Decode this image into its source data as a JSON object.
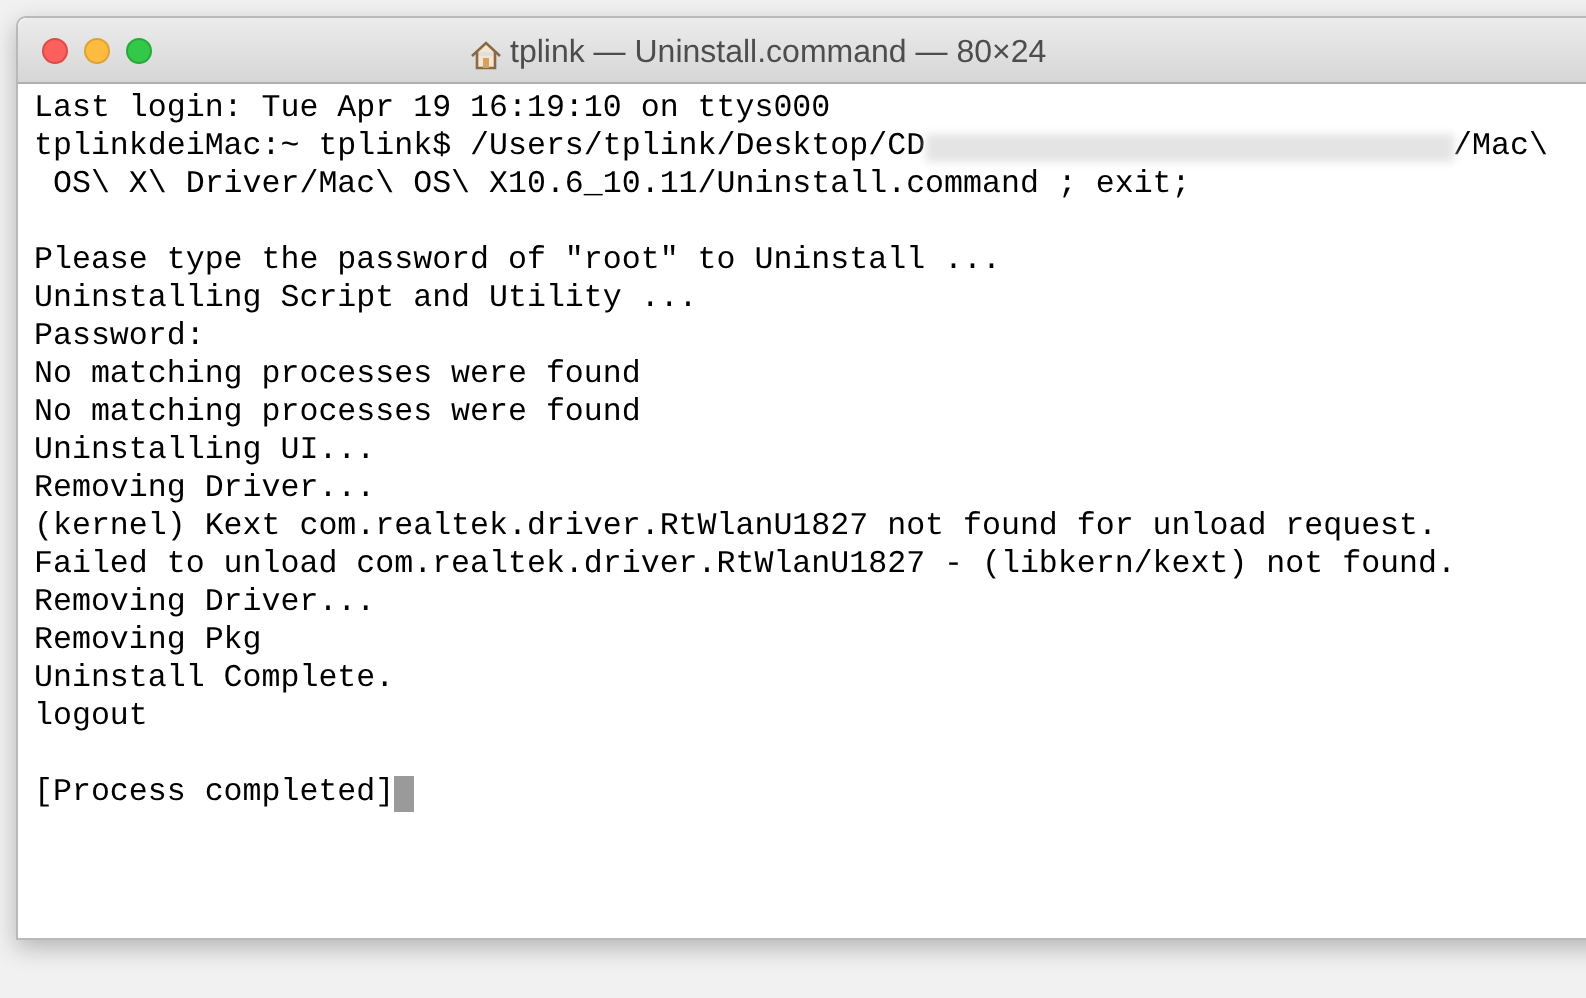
{
  "window": {
    "title": "tplink — Uninstall.command — 80×24"
  },
  "terminal": {
    "lines": [
      {
        "kind": "text",
        "text": "Last login: Tue Apr 19 16:19:10 on ttys000"
      },
      {
        "kind": "redacted",
        "before": "tplinkdeiMac:~ tplink$ /Users/tplink/Desktop/CD",
        "after": "/Mac\\"
      },
      {
        "kind": "text",
        "text": " OS\\ X\\ Driver/Mac\\ OS\\ X10.6_10.11/Uninstall.command ; exit;"
      },
      {
        "kind": "blank"
      },
      {
        "kind": "text",
        "text": "Please type the password of \"root\" to Uninstall ..."
      },
      {
        "kind": "text",
        "text": "Uninstalling Script and Utility ..."
      },
      {
        "kind": "text",
        "text": "Password:"
      },
      {
        "kind": "text",
        "text": "No matching processes were found"
      },
      {
        "kind": "text",
        "text": "No matching processes were found"
      },
      {
        "kind": "text",
        "text": "Uninstalling UI..."
      },
      {
        "kind": "text",
        "text": "Removing Driver..."
      },
      {
        "kind": "text",
        "text": "(kernel) Kext com.realtek.driver.RtWlanU1827 not found for unload request."
      },
      {
        "kind": "text",
        "text": "Failed to unload com.realtek.driver.RtWlanU1827 - (libkern/kext) not found."
      },
      {
        "kind": "text",
        "text": "Removing Driver..."
      },
      {
        "kind": "text",
        "text": "Removing Pkg"
      },
      {
        "kind": "text",
        "text": "Uninstall Complete."
      },
      {
        "kind": "text",
        "text": "logout"
      },
      {
        "kind": "blank"
      },
      {
        "kind": "cursor",
        "text": "[Process completed]"
      }
    ]
  }
}
